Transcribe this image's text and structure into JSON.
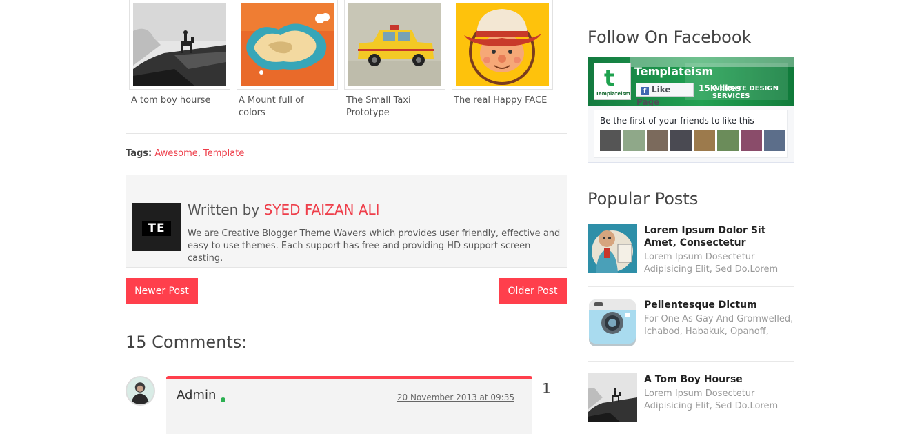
{
  "related_posts": [
    {
      "title": "A tom boy hourse",
      "image": "horse-rider-cliff"
    },
    {
      "title": "A Mount full of colors",
      "image": "colorful-island"
    },
    {
      "title": "The Small Taxi Prototype",
      "image": "yellow-taxi"
    },
    {
      "title": "The real Happy FACE",
      "image": "cowboy-face"
    }
  ],
  "tags": {
    "label": "Tags:",
    "items": [
      "Awesome",
      "Template"
    ]
  },
  "author": {
    "avatar_text": "TE",
    "written_by": "Written by",
    "name": "SYED FAIZAN ALI",
    "description": "We are Creative Blogger Theme Wavers which provides user friendly, effective and easy to use themes. Each support has free and providing HD support screen casting."
  },
  "pager": {
    "newer": "Newer Post",
    "older": "Older Post"
  },
  "comments": {
    "title": "15 Comments:",
    "items": [
      {
        "author": "Admin",
        "online": true,
        "date": "20 November 2013 at 09:35",
        "number": "1"
      }
    ]
  },
  "sidebar": {
    "facebook": {
      "title": "Follow On Facebook",
      "page_name": "Templateism",
      "like_button": "Like Page",
      "likes": "15K likes",
      "friends_text": "Be the first of your friends to like this",
      "logo_letter": "t",
      "logo_label": "Templateism",
      "cover_text_line1": "WEBSITE DESIGN",
      "cover_text_line2": "SERVICES"
    },
    "popular": {
      "title": "Popular Posts",
      "items": [
        {
          "title": "Lorem Ipsum Dolor Sit Amet, Consectetur",
          "desc": "Lorem Ipsum Dosectetur Adipisicing Elit, Sed Do.Lorem",
          "image": "cartoon-man"
        },
        {
          "title": "Pellentesque Dictum",
          "desc": "For One As Gay And Gromwelled, Ichabod, Habakuk, Opanoff,",
          "image": "camera-icon"
        },
        {
          "title": "A Tom Boy Hourse",
          "desc": "Lorem Ipsum Dosectetur Adipisicing Elit, Sed Do.Lorem",
          "image": "horse-rider-cliff"
        }
      ]
    }
  },
  "colors": {
    "accent": "#ff3f4c",
    "link": "#ee3e4a",
    "online": "#2db052",
    "facebook": "#4267b2"
  }
}
